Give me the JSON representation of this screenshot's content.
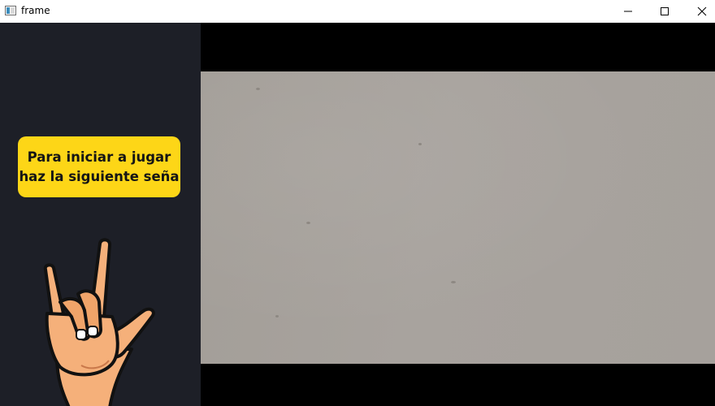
{
  "window": {
    "title": "frame"
  },
  "sidebar": {
    "prompt_text": "Para iniciar a jugar\nhaz la siguiente seña",
    "prompt_color": "#fdd617",
    "background_color": "#1d1f27",
    "gesture_icon": "rock-horns-hand-icon"
  },
  "camera": {
    "letterbox_color": "#000000",
    "feed_color": "#a6a19c"
  }
}
